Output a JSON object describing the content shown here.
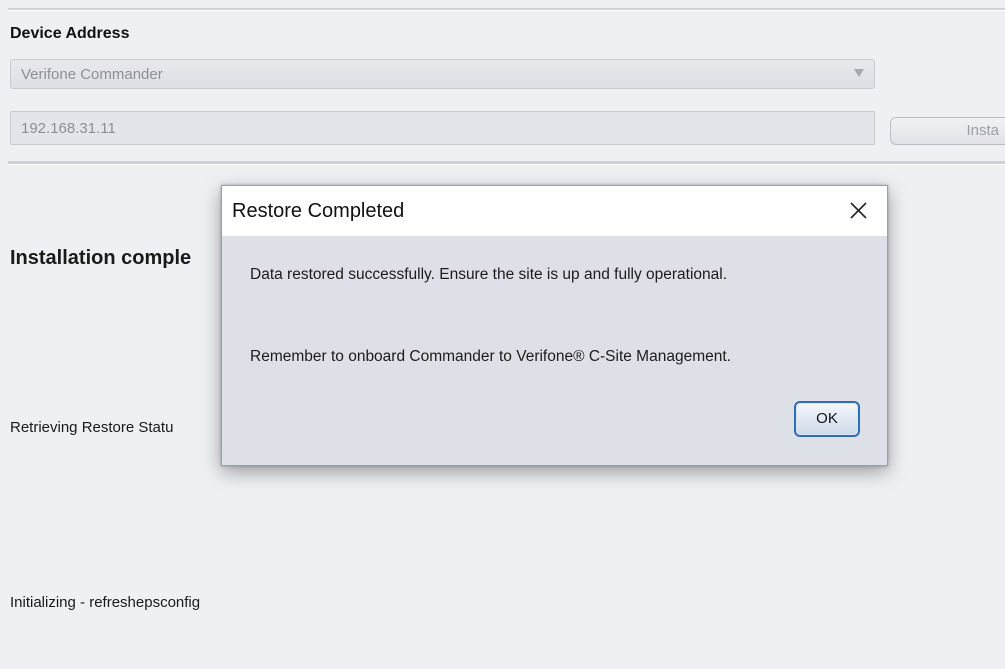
{
  "device": {
    "section_title": "Device Address",
    "selected_device": "Verifone Commander",
    "ip_address": "192.168.31.11",
    "install_button_label": "Insta"
  },
  "main": {
    "heading": "Installation comple",
    "status_1": "Retrieving Restore Statu",
    "status_2": "Initializing - refreshepsconfig"
  },
  "dialog": {
    "title": "Restore Completed",
    "message_1": "Data restored successfully. Ensure the site is up and fully operational.",
    "message_2": "Remember to onboard Commander to Verifone® C-Site Management.",
    "ok_label": "OK",
    "close_icon": "close-icon"
  },
  "colors": {
    "window_bg": "#eef0f4",
    "dialog_bg": "#dde0e6",
    "ok_border": "#2f6eb5"
  }
}
